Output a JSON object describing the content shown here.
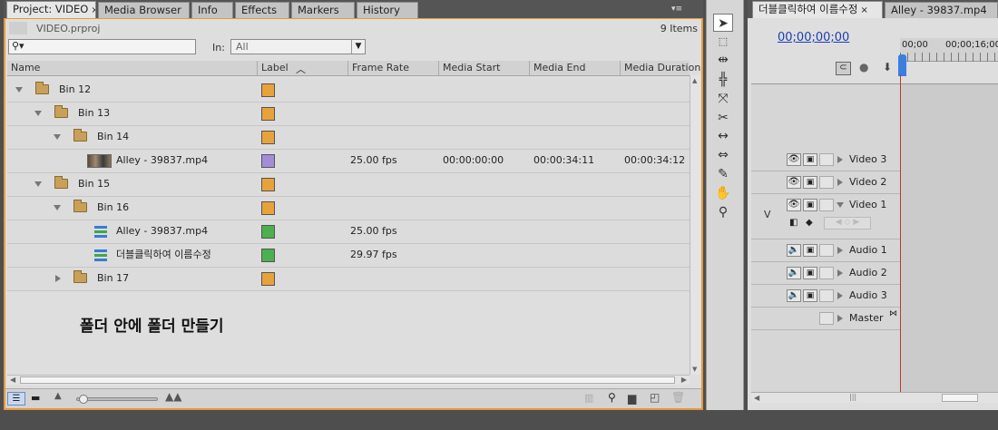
{
  "project_panel": {
    "tabs": [
      {
        "label": "Project: VIDEO",
        "close": "×"
      },
      {
        "label": "Media Browser"
      },
      {
        "label": "Info"
      },
      {
        "label": "Effects"
      },
      {
        "label": "Markers"
      },
      {
        "label": "History"
      }
    ],
    "menu_icon": "panel-menu-icon",
    "project_file": "VIDEO.prproj",
    "item_count": "9 Items",
    "search_placeholder": "",
    "in_label": "In:",
    "in_value": "All",
    "columns": [
      "Name",
      "Label",
      "Frame Rate",
      "Media Start",
      "Media End",
      "Media Duration"
    ],
    "rows": [
      {
        "name": "Bin 12",
        "type": "bin",
        "expanded": true,
        "color": "#e8a23c",
        "frame_rate": "",
        "media_start": "",
        "media_end": "",
        "media_duration": ""
      },
      {
        "name": "Bin 13",
        "type": "bin",
        "expanded": true,
        "color": "#e8a23c",
        "frame_rate": "",
        "media_start": "",
        "media_end": "",
        "media_duration": ""
      },
      {
        "name": "Bin 14",
        "type": "bin",
        "expanded": true,
        "color": "#e8a23c",
        "frame_rate": "",
        "media_start": "",
        "media_end": "",
        "media_duration": ""
      },
      {
        "name": "Alley - 39837.mp4",
        "type": "clip",
        "color": "#a58cd8",
        "frame_rate": "25.00 fps",
        "media_start": "00:00:00:00",
        "media_end": "00:00:34:11",
        "media_duration": "00:00:34:12"
      },
      {
        "name": "Bin 15",
        "type": "bin",
        "expanded": true,
        "color": "#e8a23c",
        "frame_rate": "",
        "media_start": "",
        "media_end": "",
        "media_duration": ""
      },
      {
        "name": "Bin 16",
        "type": "bin",
        "expanded": true,
        "color": "#e8a23c",
        "frame_rate": "",
        "media_start": "",
        "media_end": "",
        "media_duration": ""
      },
      {
        "name": "Alley - 39837.mp4",
        "type": "sequence",
        "color": "#4caf50",
        "frame_rate": "25.00 fps",
        "media_start": "",
        "media_end": "",
        "media_duration": ""
      },
      {
        "name": "더블클릭하여 이름수정",
        "type": "sequence",
        "color": "#4caf50",
        "frame_rate": "29.97 fps",
        "media_start": "",
        "media_end": "",
        "media_duration": ""
      },
      {
        "name": "Bin 17",
        "type": "bin",
        "expanded": false,
        "color": "#e8a23c",
        "frame_rate": "",
        "media_start": "",
        "media_end": "",
        "media_duration": ""
      }
    ],
    "overlay_caption": "폴더 안에 폴더 만들기"
  },
  "timeline_panel": {
    "tabs": [
      {
        "label": "더블클릭하여 이름수정",
        "close": "×"
      },
      {
        "label": "Alley - 39837.mp4"
      }
    ],
    "timecode": "00;00;00;00",
    "ruler_labels": [
      "00;00",
      "00;00;16;00"
    ],
    "target_label": "V",
    "video_tracks": [
      "Video 3",
      "Video 2",
      "Video 1"
    ],
    "audio_tracks": [
      "Audio 1",
      "Audio 2",
      "Audio 3"
    ],
    "master_track": "Master"
  },
  "colors": {
    "active_border": "#e49a3b",
    "playhead": "#c0392b",
    "timecode": "#1a3fb0"
  }
}
